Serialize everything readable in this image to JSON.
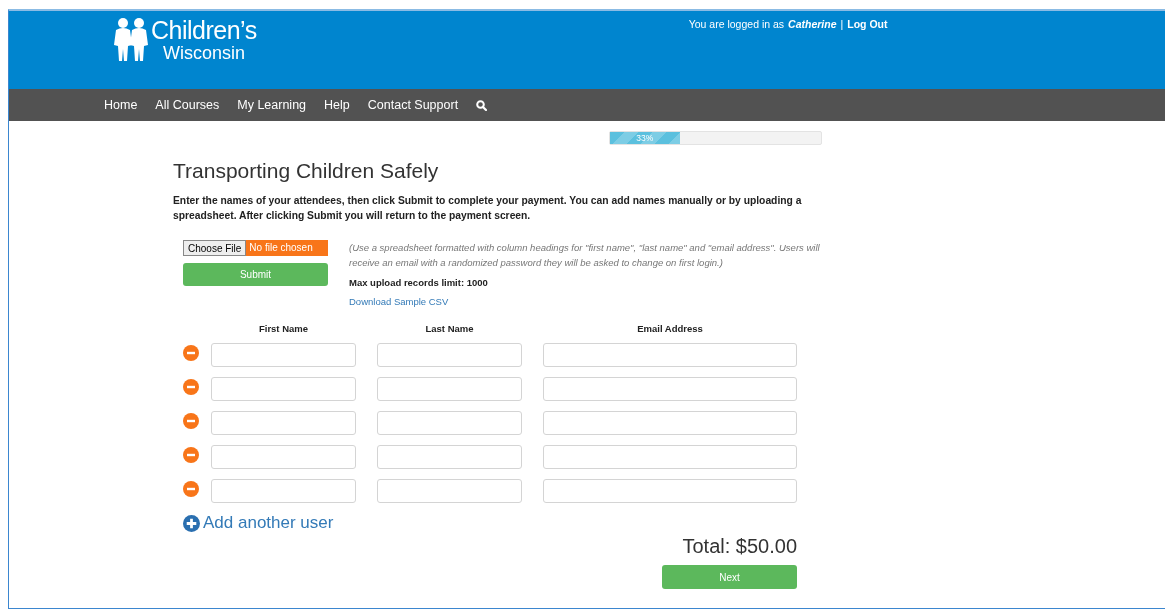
{
  "header": {
    "brand_line1": "Children’s",
    "brand_line2": "Wisconsin",
    "login_prefix": "You are logged in as",
    "user_name": "Catherine",
    "separator": "|",
    "logout": "Log Out"
  },
  "nav": {
    "items": [
      {
        "label": "Home"
      },
      {
        "label": "All Courses"
      },
      {
        "label": "My Learning"
      },
      {
        "label": "Help"
      },
      {
        "label": "Contact Support"
      }
    ]
  },
  "progress": {
    "level": 0.33,
    "label": "33%"
  },
  "title": "Transporting Children Safely",
  "instructions": "Enter the names of your attendees, then click Submit to complete your payment. You can add names manually or by uploading a spreadsheet. After clicking Submit you will return to the payment screen.",
  "upload": {
    "choose_button": "Choose File",
    "file_status": "No file chosen",
    "submit": "Submit",
    "help": "(Use a spreadsheet formatted with column headings for \"first name\", \"last name\" and \"email address\". Users will receive an email with a randomized password they will be asked to change on first login.)",
    "limit": "Max upload records limit: 1000",
    "sample_link": "Download Sample CSV"
  },
  "columns": [
    "First Name",
    "Last Name",
    "Email Address"
  ],
  "attendee_rows": [
    {
      "removable": true
    },
    {
      "removable": true
    },
    {
      "removable": true
    },
    {
      "removable": true
    },
    {
      "removable": true
    }
  ],
  "add_user": "Add another user",
  "total": "Total: $50.00",
  "next_button": "Next"
}
